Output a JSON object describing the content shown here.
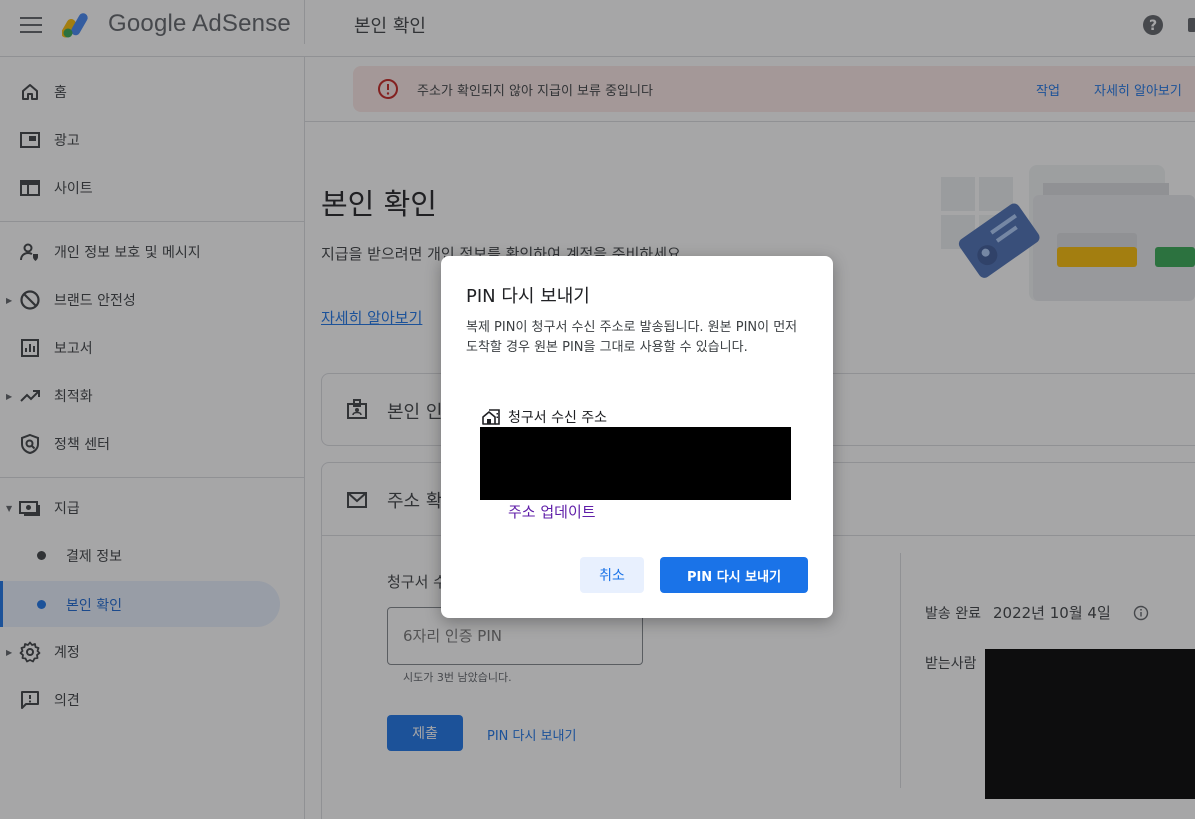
{
  "app": {
    "name": "Google AdSense",
    "page_title": "본인 확인"
  },
  "colors": {
    "accent": "#1a73e8",
    "error": "#c5221f",
    "banner_bg": "#fce8e6",
    "active_nav_bg": "#e8f0fe"
  },
  "sidebar": {
    "items": [
      {
        "label": "홈",
        "icon": "home-icon"
      },
      {
        "label": "광고",
        "icon": "ads-icon"
      },
      {
        "label": "사이트",
        "icon": "sites-icon"
      },
      {
        "label": "개인 정보 보호 및 메시지",
        "icon": "privacy-icon"
      },
      {
        "label": "브랜드 안전성",
        "icon": "block-icon",
        "expandable": true
      },
      {
        "label": "보고서",
        "icon": "reports-icon"
      },
      {
        "label": "최적화",
        "icon": "trending-icon",
        "expandable": true
      },
      {
        "label": "정책 센터",
        "icon": "policy-icon"
      },
      {
        "label": "지급",
        "icon": "payments-icon",
        "expanded": true
      },
      {
        "label": "계정",
        "icon": "gear-icon",
        "expandable": true
      },
      {
        "label": "의견",
        "icon": "feedback-icon"
      }
    ],
    "sub_items": [
      {
        "label": "결제 정보"
      },
      {
        "label": "본인 확인",
        "active": true
      }
    ]
  },
  "banner": {
    "message": "주소가 확인되지 않아 지급이 보류 중입니다",
    "action": "작업",
    "learn_more": "자세히 알아보기"
  },
  "main": {
    "title": "본인 확인",
    "description": "지급을 받으려면 개인 정보를 확인하여 계정을 준비하세요.",
    "learn_more": "자세히 알아보기",
    "identity_card_title": "본인 인",
    "address_card_title": "주소 확",
    "code_label": "청구서 수",
    "pin_placeholder": "6자리 인증 PIN",
    "attempts_left": "시도가 3번 남았습니다.",
    "submit": "제출",
    "resend_pin": "PIN 다시 보내기",
    "sent_label": "발송 완료",
    "sent_date": "2022년 10월 4일",
    "recipient_label": "받는사람"
  },
  "dialog": {
    "title": "PIN 다시 보내기",
    "body": "복제 PIN이 청구서 수신 주소로 발송됩니다. 원본 PIN이 먼저 도착할 경우 원본 PIN을 그대로 사용할 수 있습니다.",
    "address_label": "청구서 수신 주소",
    "update_address": "주소 업데이트",
    "cancel": "취소",
    "confirm": "PIN 다시 보내기"
  }
}
